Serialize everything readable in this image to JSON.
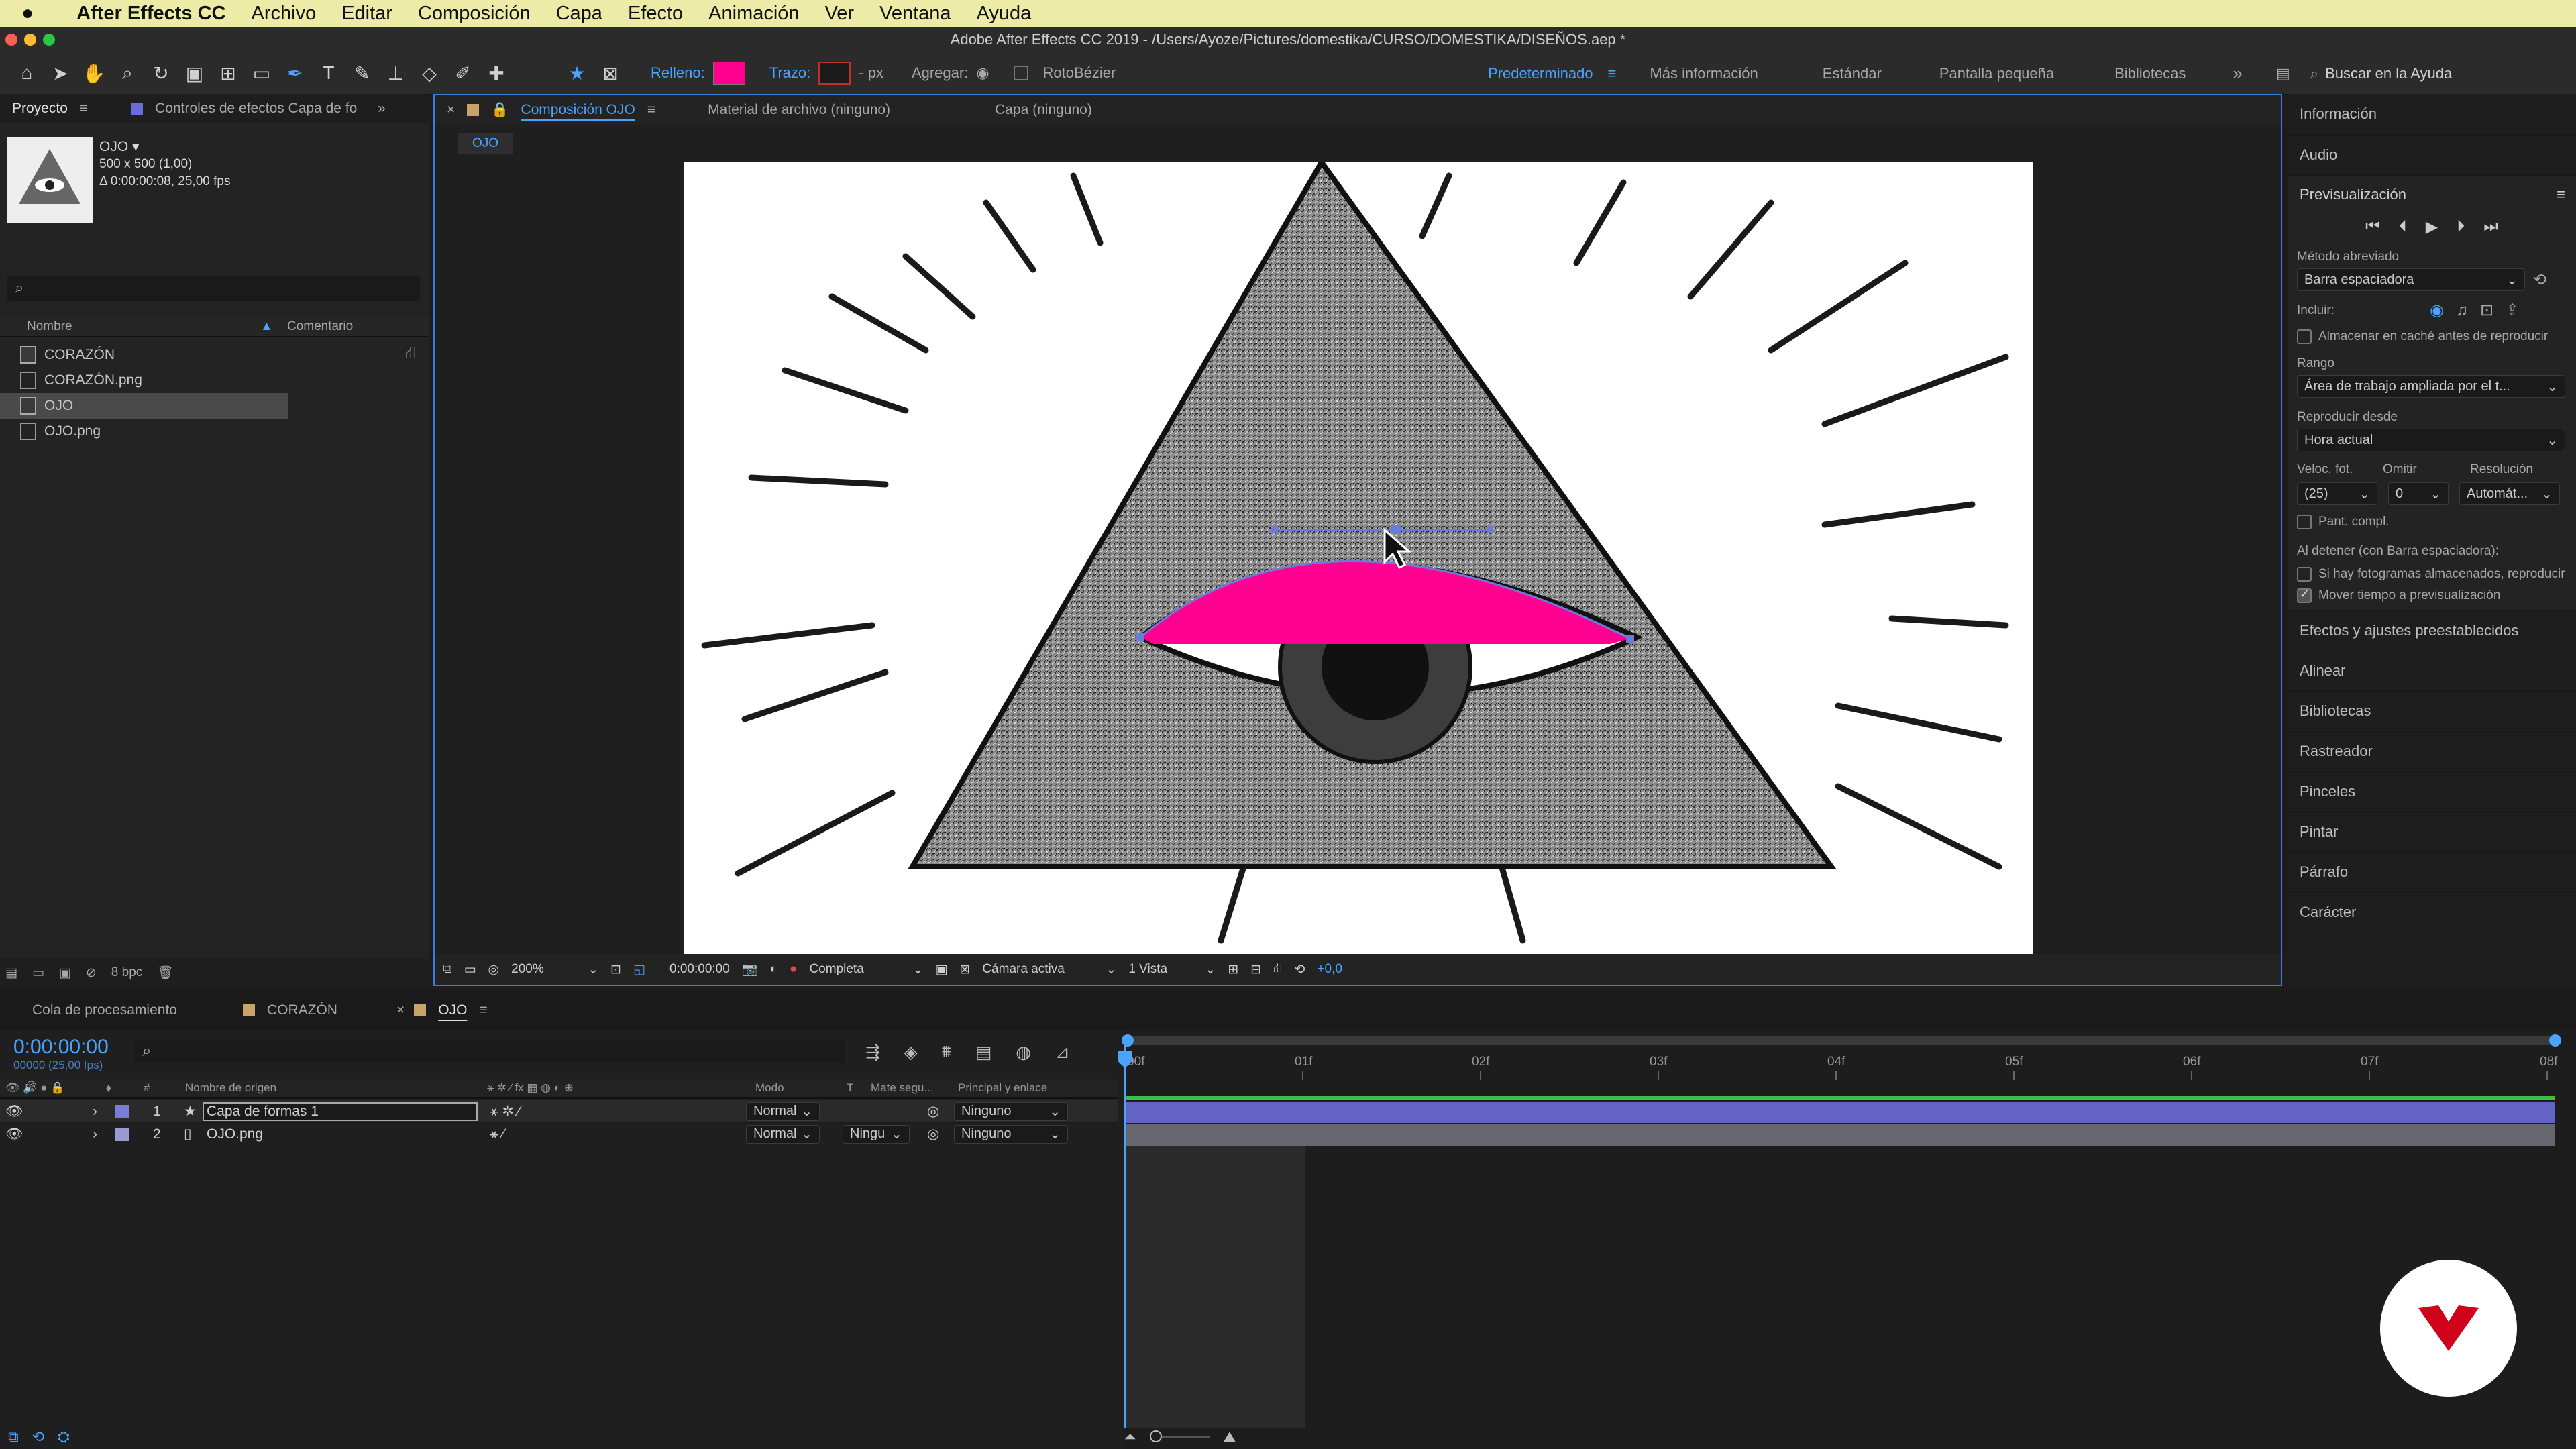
{
  "menubar": {
    "app": "After Effects CC",
    "items": [
      "Archivo",
      "Editar",
      "Composición",
      "Capa",
      "Efecto",
      "Animación",
      "Ver",
      "Ventana",
      "Ayuda"
    ]
  },
  "window": {
    "title": "Adobe After Effects CC 2019 - /Users/Ayoze/Pictures/domestika/CURSO/DOMESTIKA/DISEÑOS.aep *"
  },
  "toolbar": {
    "fill_label": "Relleno:",
    "fill_color": "#ff0090",
    "stroke_label": "Trazo:",
    "stroke_unit": "- px",
    "add_label": "Agregar:",
    "rotobezier_label": "RotoBézier",
    "workspaces": [
      "Predeterminado",
      "Más información",
      "Estándar",
      "Pantalla pequeña",
      "Bibliotecas"
    ],
    "active_workspace": "Predeterminado",
    "search_placeholder": "Buscar en la Ayuda"
  },
  "project": {
    "tab": "Proyecto",
    "effects_tab": "Controles de efectos Capa de fo",
    "item_name": "OJO ▾",
    "item_size": "500 x 500 (1,00)",
    "item_duration": "Δ 0:00:00:08, 25,00 fps",
    "col_name": "Nombre",
    "col_comment": "Comentario",
    "items": [
      {
        "name": "CORAZÓN",
        "kind": "comp"
      },
      {
        "name": "CORAZÓN.png",
        "kind": "file"
      },
      {
        "name": "OJO",
        "kind": "comp",
        "selected": true
      },
      {
        "name": "OJO.png",
        "kind": "file"
      }
    ],
    "bpc": "8 bpc"
  },
  "viewer": {
    "tab": "Composición OJO",
    "footage_tab": "Material de archivo (ninguno)",
    "layer_tab": "Capa (ninguno)",
    "breadcrumb": "OJO",
    "zoom": "200%",
    "timecode": "0:00:00:00",
    "resolution": "Completa",
    "camera": "Cámara activa",
    "views": "1 Vista",
    "exposure": "+0,0",
    "shape_color": "#ff0090"
  },
  "right_panel": {
    "info": "Información",
    "audio": "Audio",
    "preview": "Previsualización",
    "shortcut_label": "Método abreviado",
    "shortcut_value": "Barra espaciadora",
    "include_label": "Incluir:",
    "cache_label": "Almacenar en caché antes de reproducir",
    "range_label": "Rango",
    "range_value": "Área de trabajo ampliada por el t...",
    "play_from_label": "Reproducir desde",
    "play_from_value": "Hora actual",
    "fps_label": "Veloc. fot.",
    "skip_label": "Omitir",
    "res_label": "Resolución",
    "fps_value": "(25)",
    "skip_value": "0",
    "res_value": "Automát...",
    "fullscreen_label": "Pant. compl.",
    "on_stop_label": "Al detener (con Barra espaciadora):",
    "cached_label": "Si hay fotogramas almacenados, reproducir",
    "move_time_label": "Mover tiempo a previsualización",
    "panels": [
      "Efectos y ajustes preestablecidos",
      "Alinear",
      "Bibliotecas",
      "Rastreador",
      "Pinceles",
      "Pintar",
      "Párrafo",
      "Carácter"
    ]
  },
  "timeline": {
    "tabs": [
      "Cola de procesamiento",
      "CORAZÓN",
      "OJO"
    ],
    "active_tab": "OJO",
    "timecode": "0:00:00:00",
    "frames": "00000 (25,00 fps)",
    "headers": {
      "num": "#",
      "source": "Nombre de origen",
      "mode": "Modo",
      "t": "T",
      "matte": "Mate segu...",
      "parent": "Principal y enlace"
    },
    "layers": [
      {
        "num": "1",
        "name": "Capa de formas 1",
        "mode": "Normal",
        "matte": "",
        "parent": "Ninguno",
        "color": "#7b7bd8"
      },
      {
        "num": "2",
        "name": "OJO.png",
        "mode": "Normal",
        "matte": "Ningu",
        "parent": "Ninguno",
        "color": "#9a9ad0"
      }
    ],
    "ruler": [
      "00f",
      "01f",
      "02f",
      "03f",
      "04f",
      "05f",
      "06f",
      "07f",
      "08f"
    ]
  }
}
